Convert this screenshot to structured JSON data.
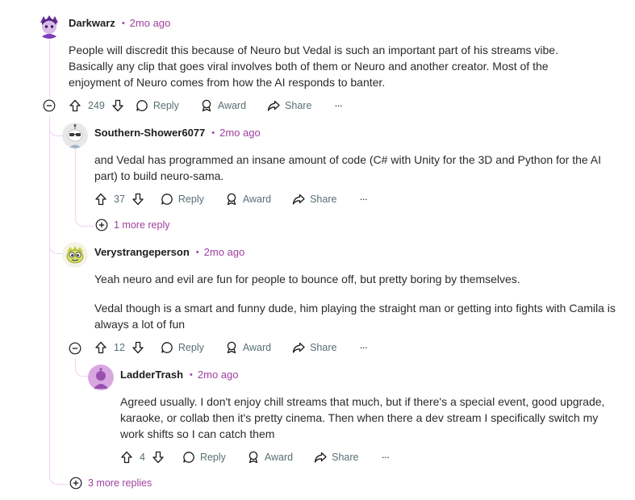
{
  "colors": {
    "accent": "#a0409f",
    "thread_line": "#f2d2f2",
    "action_text": "#576f76"
  },
  "actions": {
    "reply": "Reply",
    "award": "Award",
    "share": "Share",
    "more": "···"
  },
  "comments": [
    {
      "author": "Darkwarz",
      "time": "2mo ago",
      "votes": "249",
      "body": [
        "People will discredit this because of Neuro but Vedal is such an important part of his streams vibe. Basically any clip that goes viral involves both of them or Neuro and another creator. Most of the enjoyment of Neuro comes from how the AI responds to banter."
      ]
    },
    {
      "author": "Southern-Shower6077",
      "time": "2mo ago",
      "votes": "37",
      "body": [
        "and Vedal has programmed an insane amount of code (C# with Unity for the 3D and Python for the AI part) to build neuro-sama."
      ],
      "more_replies": "1 more reply"
    },
    {
      "author": "Verystrangeperson",
      "time": "2mo ago",
      "votes": "12",
      "body": [
        "Yeah neuro and evil are fun for people to bounce off, but pretty boring by themselves.",
        "Vedal though is a smart and funny dude, him playing the straight man or getting into fights with Camila is always a lot of fun"
      ]
    },
    {
      "author": "LadderTrash",
      "time": "2mo ago",
      "votes": "4",
      "body": [
        "Agreed usually. I don't enjoy chill streams that much, but if there's a special event, good upgrade, karaoke, or collab then it's pretty cinema. Then when there a dev stream I specifically switch my work shifts so I can catch them"
      ]
    }
  ],
  "thread_more_replies": "3 more replies"
}
